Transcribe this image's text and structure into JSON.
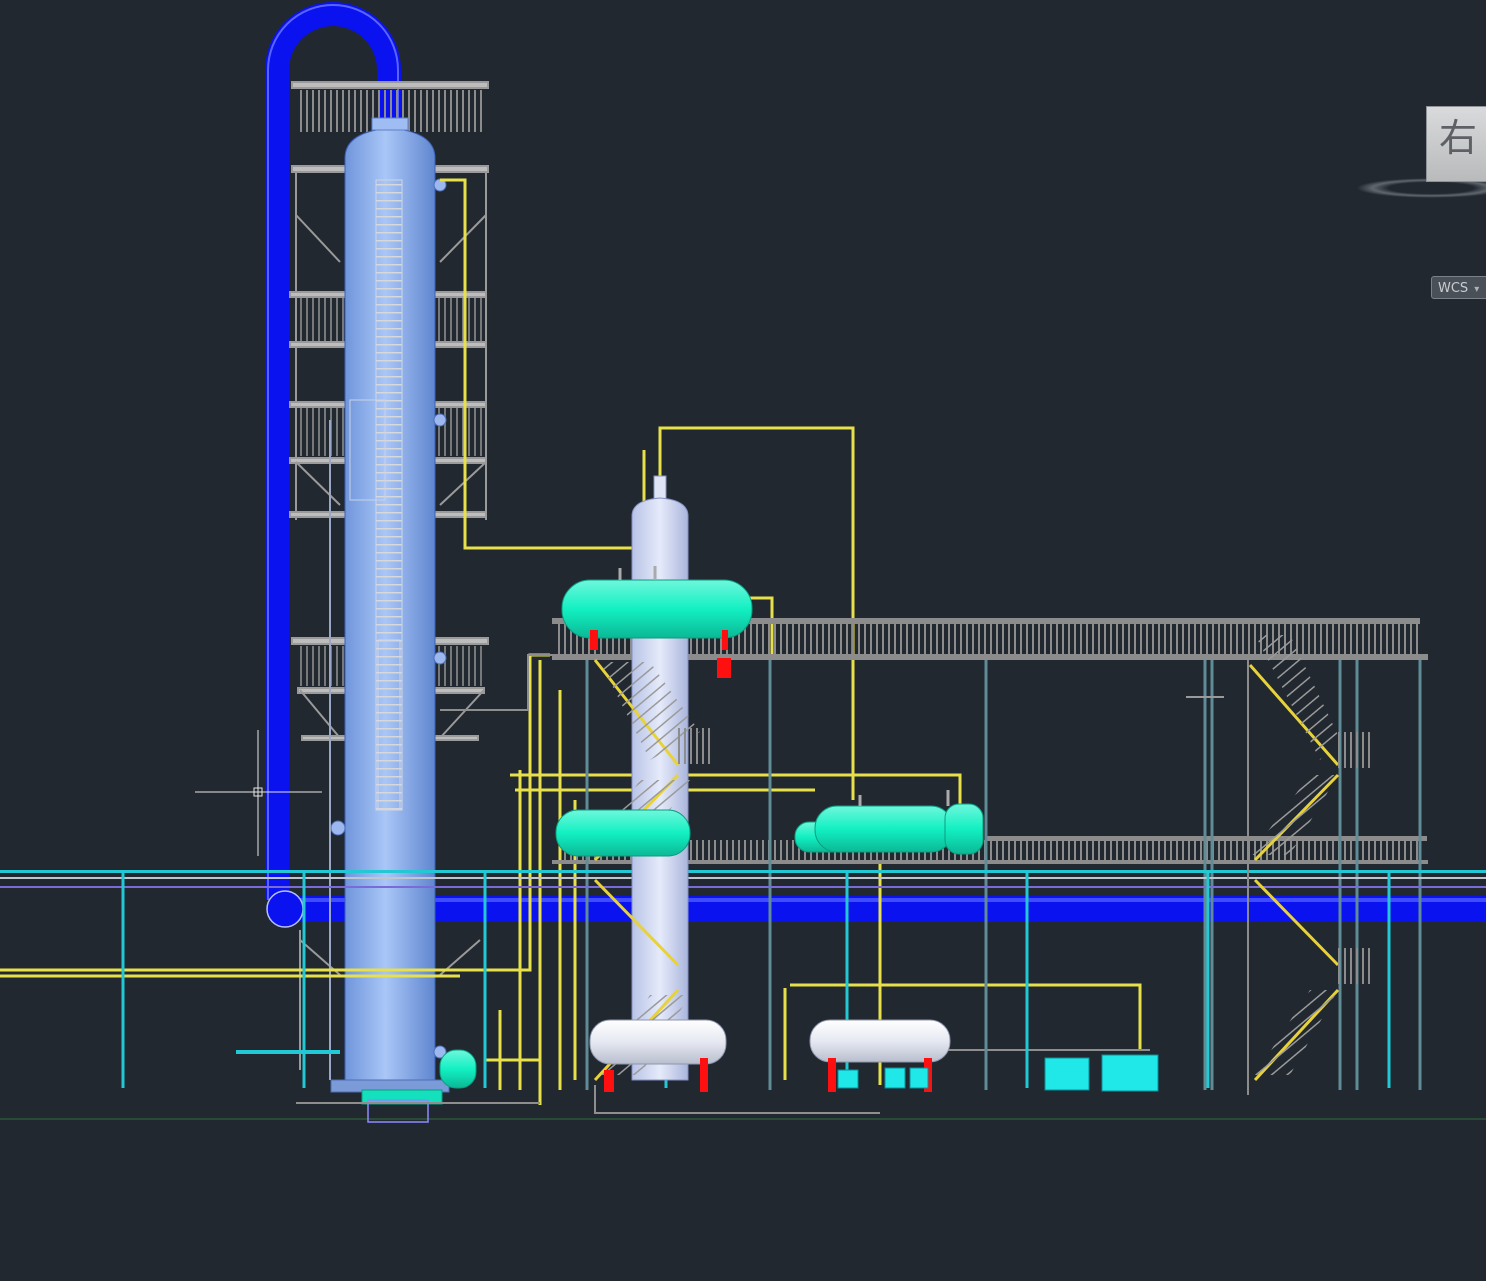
{
  "viewcube": {
    "face_label": "右"
  },
  "ucs_menu": {
    "label": "WCS",
    "caret": "▾"
  },
  "icons": {
    "viewcube": "viewcube-icon",
    "compass": "compass-ring-icon",
    "crosshair": "crosshair-cursor-icon"
  },
  "colors": {
    "background": "#212830",
    "overhead_pipe": "#0a12f0",
    "tower_shell": "#8fb3f0",
    "drum": "#16f2c4",
    "process_line": "#e8e04a",
    "steel": "#8a8a8a",
    "utility_pipe": "#22c9d4",
    "valve": "#ff1010",
    "pump": "#20e8e8",
    "receiver": "#e4e8f0"
  }
}
